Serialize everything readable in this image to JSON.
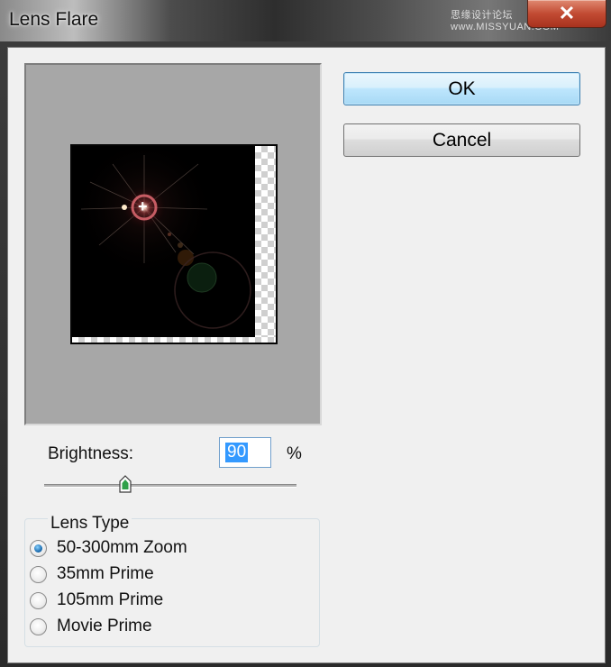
{
  "window": {
    "title": "Lens Flare",
    "watermark": "思缘设计论坛 www.MISSYUAN.COM",
    "close_glyph": "✕"
  },
  "buttons": {
    "ok_label": "OK",
    "cancel_label": "Cancel"
  },
  "brightness": {
    "label": "Brightness:",
    "value": "90",
    "unit": "%",
    "slider_fraction": 0.32
  },
  "lens_type": {
    "title": "Lens Type",
    "options": [
      {
        "label": "50-300mm Zoom",
        "checked": true
      },
      {
        "label": "35mm Prime",
        "checked": false
      },
      {
        "label": "105mm Prime",
        "checked": false
      },
      {
        "label": "Movie Prime",
        "checked": false
      }
    ]
  },
  "preview": {
    "crosshair_glyph": "+"
  },
  "colors": {
    "dialog_bg": "#f0f0f0",
    "preview_bg": "#a7a7a7",
    "ok_accent": "#3c7fb1",
    "selection": "#3399ff",
    "close_red": "#c24b33"
  },
  "icons": {
    "close": "close-icon",
    "crosshair": "crosshair-icon",
    "slider_thumb": "slider-thumb-icon"
  }
}
